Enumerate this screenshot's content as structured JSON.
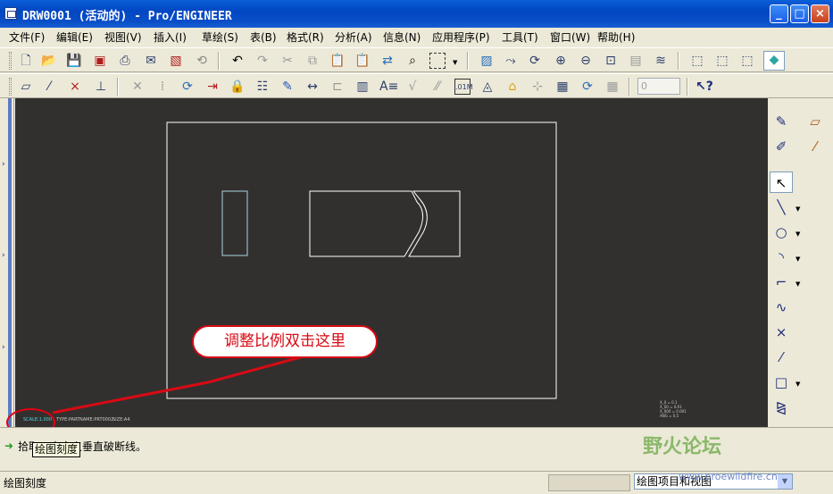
{
  "window": {
    "title": "DRW0001 (活动的) - Pro/ENGINEER"
  },
  "menu": [
    "文件(F)",
    "编辑(E)",
    "视图(V)",
    "插入(I)",
    "草绘(S)",
    "表(B)",
    "格式(R)",
    "分析(A)",
    "信息(N)",
    "应用程序(P)",
    "工具(T)",
    "窗口(W)",
    "帮助(H)"
  ],
  "toolbar": {
    "spinner_value": "0"
  },
  "canvas": {
    "scale_text": "SCALE:1.000",
    "type_text": "TYPE:PART",
    "name_text": "NAME:PRT0002",
    "size_text": "SIZE:A4",
    "corner_note": [
      "X_0  = 0.1",
      "X_00 = 0.01",
      "X_000 = 0.001",
      "ANG = 0.5"
    ]
  },
  "callout": {
    "text": "调整比例双击这里"
  },
  "status": {
    "message": "拾取一点定义垂直破断线。",
    "tooltip": "绘图刻度",
    "bottom_left": "绘图刻度",
    "filter": "绘图项目和视图"
  },
  "watermark": {
    "text": "野火论坛",
    "url": "www.proewildfire.cn"
  },
  "colors": {
    "canvas_bg": "#32302e",
    "geometry": "#ffffff",
    "view_outline": "#a9d3e0",
    "callout": "#d80a14"
  }
}
